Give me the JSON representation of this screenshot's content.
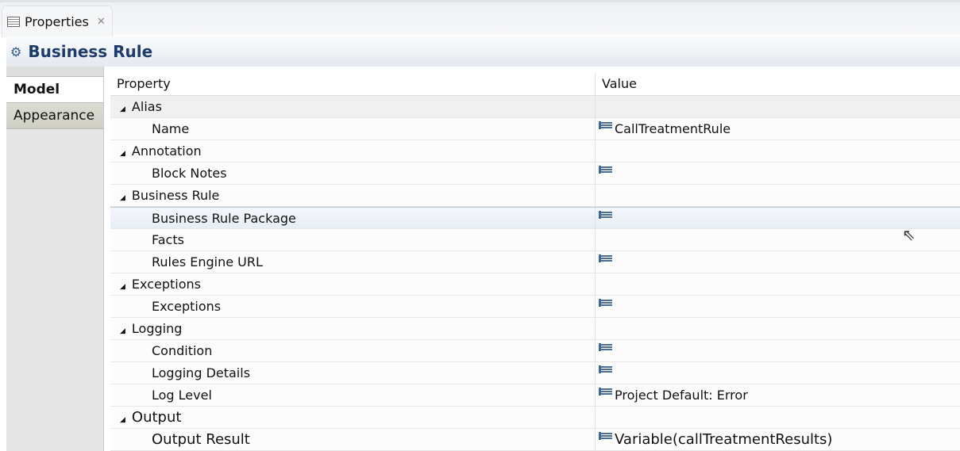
{
  "tab": {
    "label": "Properties",
    "close": "✕"
  },
  "title": "Business Rule",
  "side_tabs": [
    {
      "label": "Model",
      "active": true
    },
    {
      "label": "Appearance",
      "active": false
    }
  ],
  "columns": {
    "property": "Property",
    "value": "Value"
  },
  "rows": [
    {
      "type": "cat",
      "label": "Alias"
    },
    {
      "type": "child",
      "label": "Name",
      "icon": true,
      "value": "CallTreatmentRule"
    },
    {
      "type": "cat",
      "label": "Annotation"
    },
    {
      "type": "child",
      "label": "Block Notes",
      "icon": true,
      "value": ""
    },
    {
      "type": "cat",
      "label": "Business Rule"
    },
    {
      "type": "child",
      "label": "Business Rule Package",
      "icon": true,
      "value": "",
      "hover": true
    },
    {
      "type": "child",
      "label": "Facts",
      "icon": false,
      "value": ""
    },
    {
      "type": "child",
      "label": "Rules Engine URL",
      "icon": true,
      "value": ""
    },
    {
      "type": "cat",
      "label": "Exceptions"
    },
    {
      "type": "child",
      "label": "Exceptions",
      "icon": true,
      "value": ""
    },
    {
      "type": "cat",
      "label": "Logging"
    },
    {
      "type": "child",
      "label": "Condition",
      "icon": true,
      "value": ""
    },
    {
      "type": "child",
      "label": "Logging Details",
      "icon": true,
      "value": ""
    },
    {
      "type": "child",
      "label": "Log Level",
      "icon": true,
      "value": "Project Default: Error"
    },
    {
      "type": "cat",
      "label": "Output",
      "big": true
    },
    {
      "type": "child",
      "label": "Output Result",
      "icon": true,
      "value": "Variable(callTreatmentResults)",
      "big": true
    }
  ]
}
